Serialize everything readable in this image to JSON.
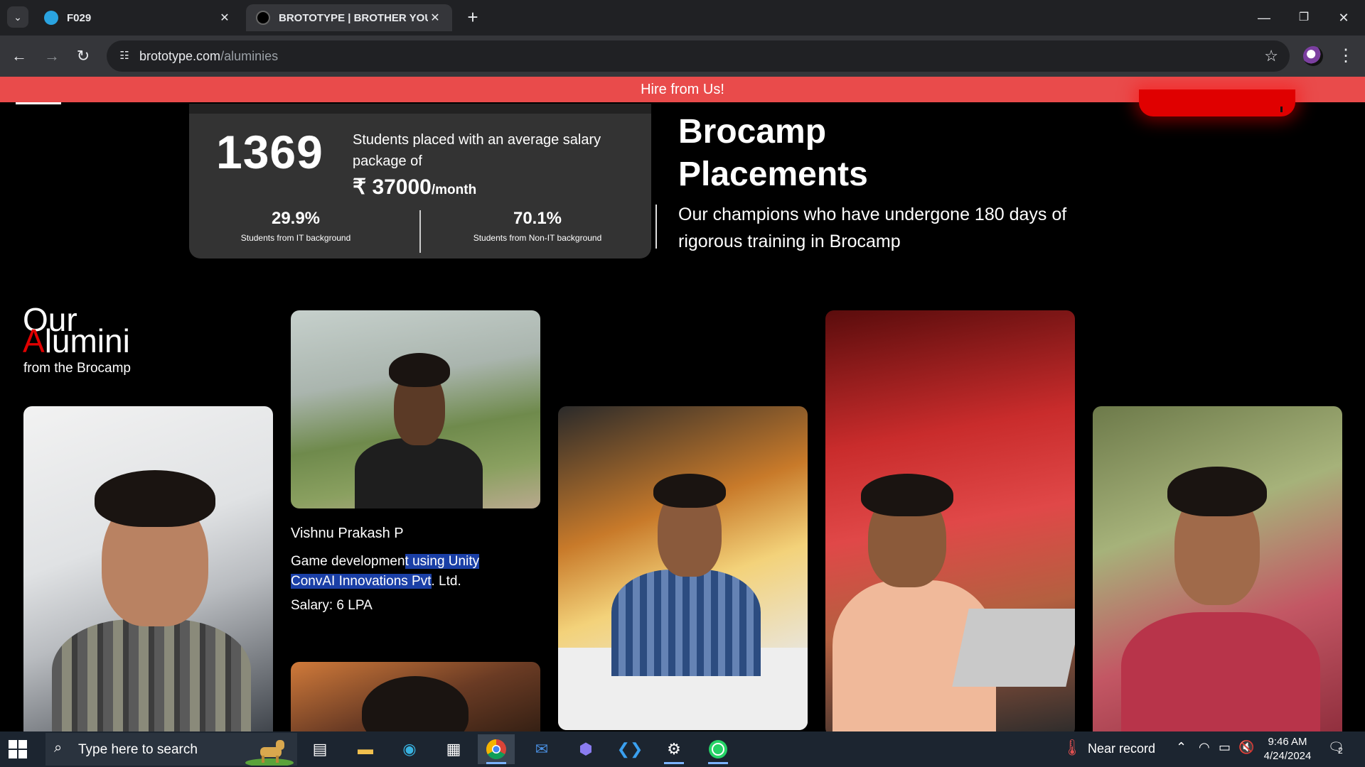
{
  "browser": {
    "tabs": [
      {
        "title": "F029",
        "favicon": "telegram-icon",
        "active": false
      },
      {
        "title": "BROTOTYPE | BROTHER YOU N",
        "favicon": "brototype-icon",
        "active": true
      }
    ],
    "url_domain": "brototype.com",
    "url_path": "/aluminies"
  },
  "page": {
    "hire_banner": "Hire from Us!",
    "stats": {
      "placed_count": "1369",
      "placed_text": "Students placed with an average salary package of",
      "salary_symbol": "₹",
      "salary_amount": "37000",
      "salary_unit": "/month",
      "it_pct": "29.9%",
      "it_label": "Students from IT background",
      "nonit_pct": "70.1%",
      "nonit_label": "Students from Non-IT background"
    },
    "placements": {
      "title_line1": "Brocamp",
      "title_line2": "Placements",
      "description": "Our champions who have undergone 180 days of rigorous training in Brocamp"
    },
    "alumini": {
      "our": "Our",
      "letter_a": "A",
      "rest": "lumini",
      "sub": "from the Brocamp"
    },
    "featured": {
      "name": "Vishnu Prakash P",
      "role_part1": "Game developmen",
      "role_part2": "t using Unity",
      "company_part1": "ConvAI Innovations Pvt",
      "company_part2": ". Ltd.",
      "salary": "Salary: 6 LPA"
    }
  },
  "taskbar": {
    "search_placeholder": "Type here to search",
    "weather": "Near record",
    "time": "9:46 AM",
    "date": "4/24/2024",
    "notification_count": "2"
  },
  "colors": {
    "hire_bar": "#e94b4b",
    "accent_red": "#e00000",
    "card_bg": "#333333"
  }
}
